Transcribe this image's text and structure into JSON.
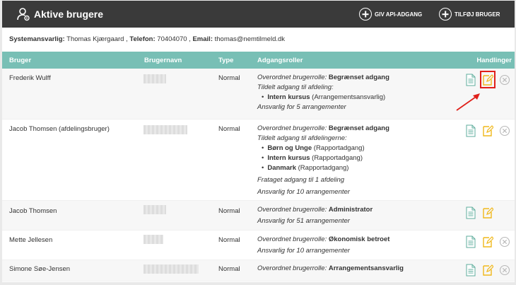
{
  "header": {
    "title": "Aktive brugere",
    "api_button": "GIV API-ADGANG",
    "add_button": "TILFØJ BRUGER"
  },
  "system": {
    "label_responsible": "Systemansvarlig:",
    "responsible": "Thomas Kjærgaard ,",
    "label_phone": "Telefon:",
    "phone": "70404070 ,",
    "label_email": "Email:",
    "email": "thomas@nemtilmeld.dk"
  },
  "columns": {
    "bruger": "Bruger",
    "brugernavn": "Brugernavn",
    "type": "Type",
    "roller": "Adgangsroller",
    "handlinger": "Handlinger"
  },
  "rows": [
    {
      "name": "Frederik Wulff",
      "type": "Normal",
      "role_label": "Overordnet brugerrolle:",
      "role": "Begrænset adgang",
      "dept_label": "Tildelt adgang til afdeling:",
      "depts": [
        {
          "name": "Intern kursus",
          "role": "(Arrangementsansvarlig)"
        }
      ],
      "responsible": "Ansvarlig for 5 arrangementer"
    },
    {
      "name": "Jacob Thomsen (afdelingsbruger)",
      "type": "Normal",
      "role_label": "Overordnet brugerrolle:",
      "role": "Begrænset adgang",
      "dept_label": "Tildelt adgang til afdelingerne:",
      "depts": [
        {
          "name": "Børn og Unge",
          "role": "(Rapportadgang)"
        },
        {
          "name": "Intern kursus",
          "role": "(Rapportadgang)"
        },
        {
          "name": "Danmark",
          "role": "(Rapportadgang)"
        }
      ],
      "revoked": "Frataget adgang til 1 afdeling",
      "responsible": "Ansvarlig for 10 arrangementer"
    },
    {
      "name": "Jacob Thomsen",
      "type": "Normal",
      "role_label": "Overordnet brugerrolle:",
      "role": "Administrator",
      "responsible": "Ansvarlig for 51 arrangementer"
    },
    {
      "name": "Mette Jellesen",
      "type": "Normal",
      "role_label": "Overordnet brugerrolle:",
      "role": "Økonomisk betroet",
      "responsible": "Ansvarlig for 10 arrangementer"
    },
    {
      "name": "Simone Søe-Jensen",
      "type": "Normal",
      "role_label": "Overordnet brugerrolle:",
      "role": "Arrangementsansvarlig"
    }
  ],
  "icons": {
    "header": "user-gear-icon",
    "doc": "document-icon",
    "edit": "edit-icon",
    "delete": "circle-x-icon"
  },
  "colors": {
    "header_bg": "#3a3a3a",
    "table_header": "#78bfb5",
    "doc_icon": "#5fae9c",
    "edit_icon": "#f0b81c",
    "highlight": "#e0201a"
  }
}
